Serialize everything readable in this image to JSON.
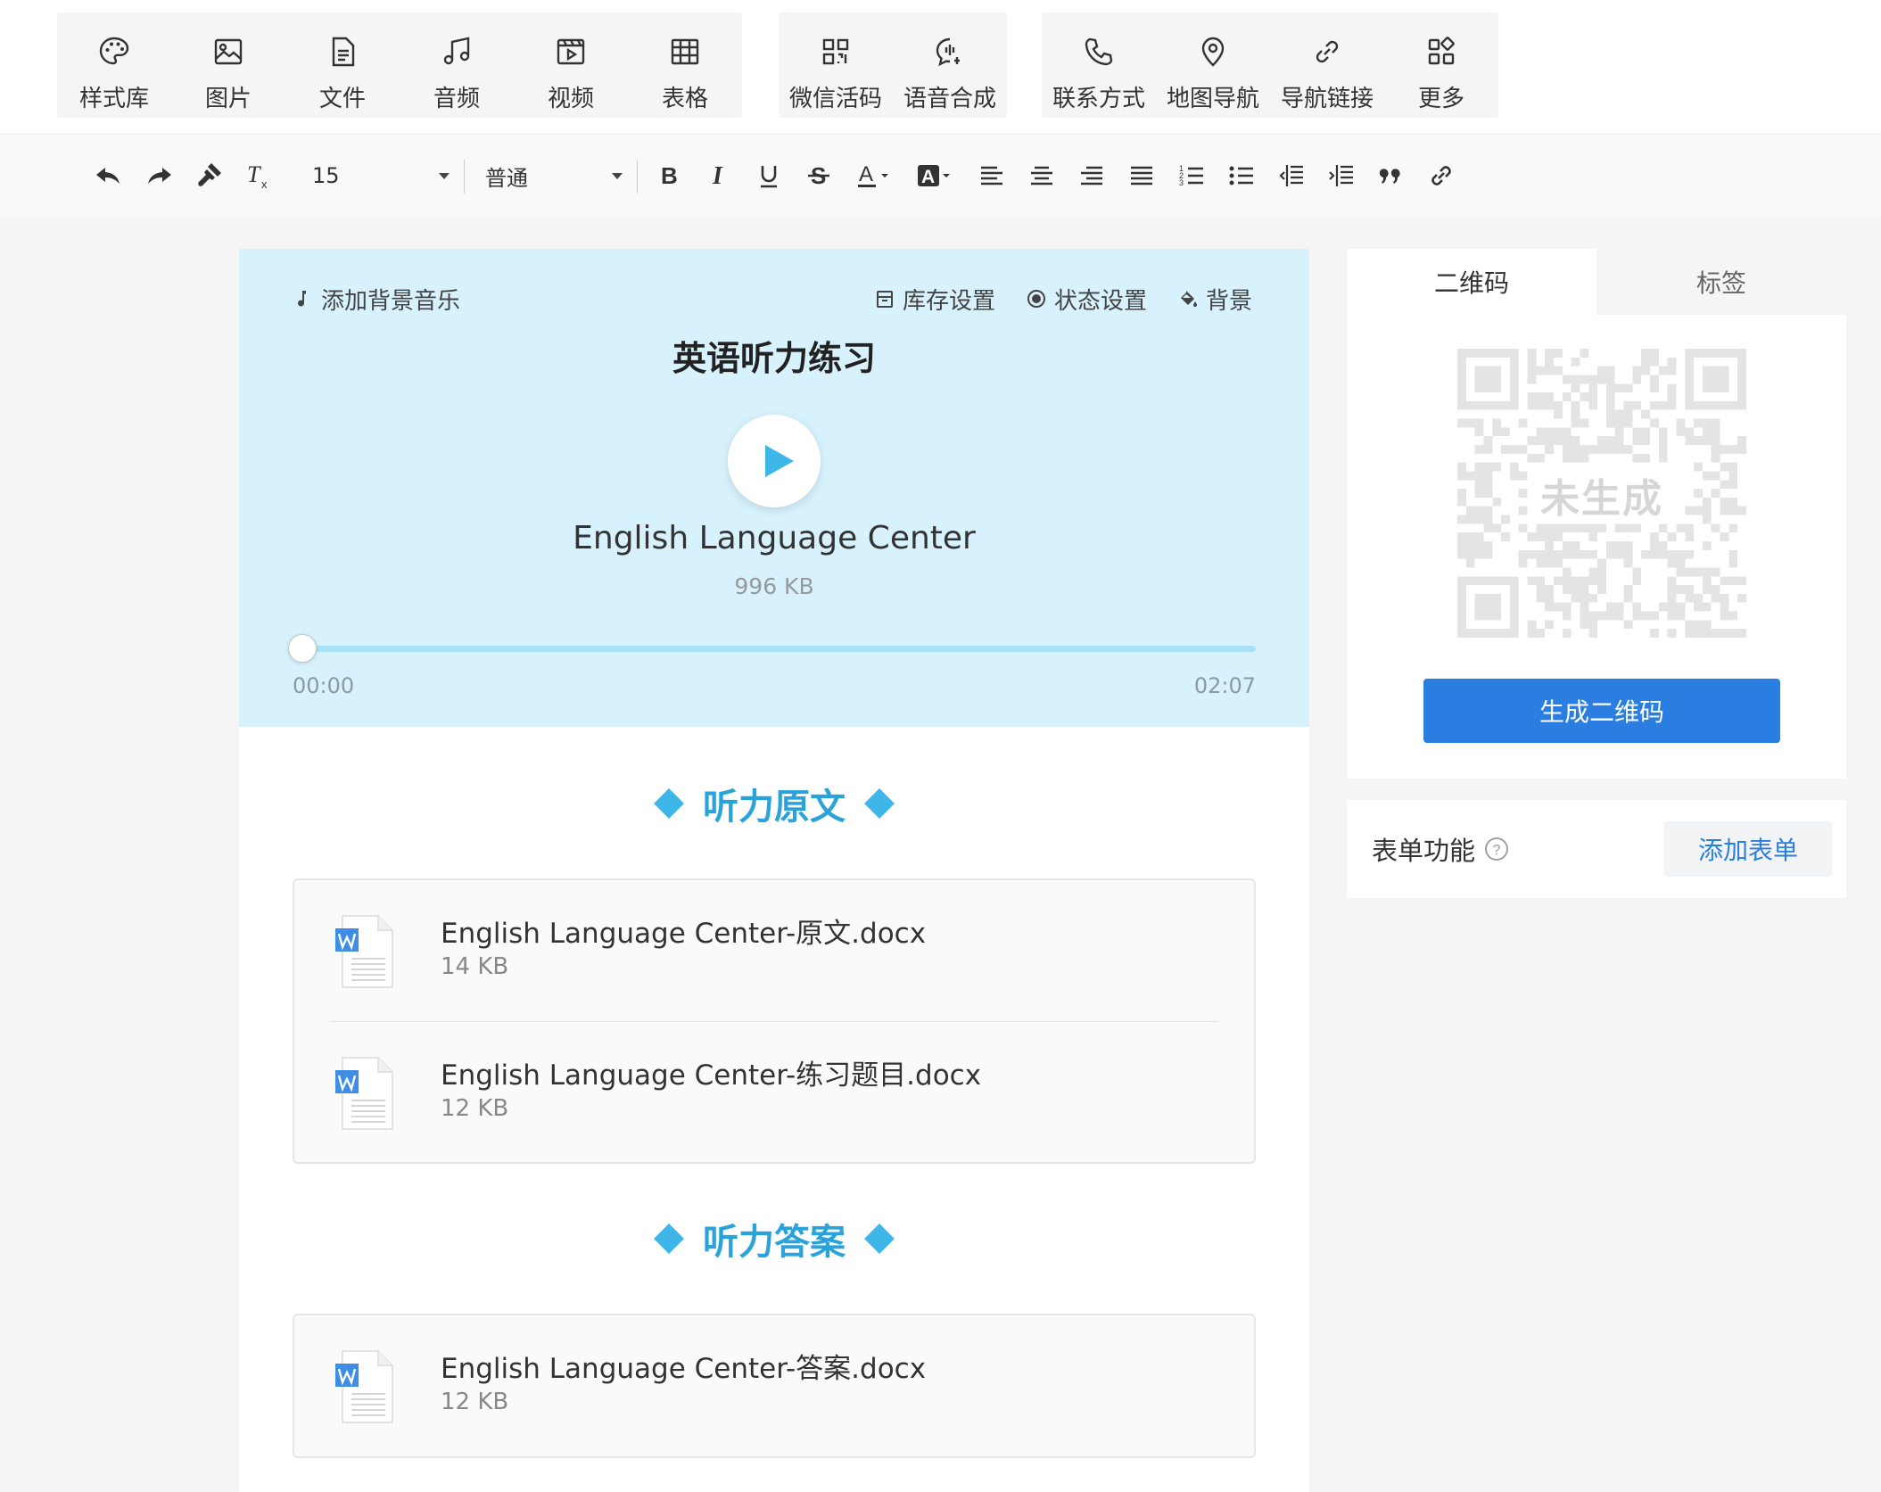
{
  "top_toolbar": {
    "groups": [
      {
        "items": [
          {
            "label": "样式库",
            "icon": "palette-icon"
          },
          {
            "label": "图片",
            "icon": "image-icon"
          },
          {
            "label": "文件",
            "icon": "file-icon"
          },
          {
            "label": "音频",
            "icon": "music-icon"
          },
          {
            "label": "视频",
            "icon": "video-icon"
          },
          {
            "label": "表格",
            "icon": "table-icon"
          }
        ]
      },
      {
        "items": [
          {
            "label": "微信活码",
            "icon": "qrcode-icon"
          },
          {
            "label": "语音合成",
            "icon": "voice-bubble-icon"
          }
        ]
      },
      {
        "items": [
          {
            "label": "联系方式",
            "icon": "phone-icon"
          },
          {
            "label": "地图导航",
            "icon": "map-pin-icon"
          },
          {
            "label": "导航链接",
            "icon": "link-icon"
          },
          {
            "label": "更多",
            "icon": "grid-more-icon"
          }
        ]
      }
    ]
  },
  "format_toolbar": {
    "font_size": "15",
    "paragraph_style": "普通",
    "buttons": [
      "undo-icon",
      "redo-icon",
      "format-painter-icon",
      "clear-format-icon",
      "bold-icon",
      "italic-icon",
      "underline-icon",
      "strikethrough-icon",
      "font-color-icon",
      "highlight-color-icon",
      "align-left-icon",
      "align-center-icon",
      "align-right-icon",
      "align-justify-icon",
      "ordered-list-icon",
      "unordered-list-icon",
      "outdent-icon",
      "indent-icon",
      "quote-icon",
      "link-icon"
    ]
  },
  "audio_card": {
    "add_music_label": "添加背景音乐",
    "stock_settings_label": "库存设置",
    "status_settings_label": "状态设置",
    "background_label": "背景",
    "title": "英语听力练习",
    "audio_name": "English Language Center",
    "audio_size": "996 KB",
    "current_time": "00:00",
    "total_time": "02:07",
    "progress": 0.01,
    "background_color": "#d7f2fd",
    "accent_color": "#3fb6e8"
  },
  "sections": [
    {
      "heading": "听力原文",
      "files": [
        {
          "name": "English Language Center-原文.docx",
          "size": "14 KB"
        },
        {
          "name": "English Language Center-练习题目.docx",
          "size": "12 KB"
        }
      ]
    },
    {
      "heading": "听力答案",
      "files": [
        {
          "name": "English Language Center-答案.docx",
          "size": "12 KB"
        }
      ]
    }
  ],
  "side_panel": {
    "tabs": [
      "二维码",
      "标签"
    ],
    "active_tab": 0,
    "qr_placeholder": "未生成",
    "generate_button": "生成二维码",
    "form_label": "表单功能",
    "add_form_button": "添加表单",
    "primary_color": "#2a7de1"
  }
}
